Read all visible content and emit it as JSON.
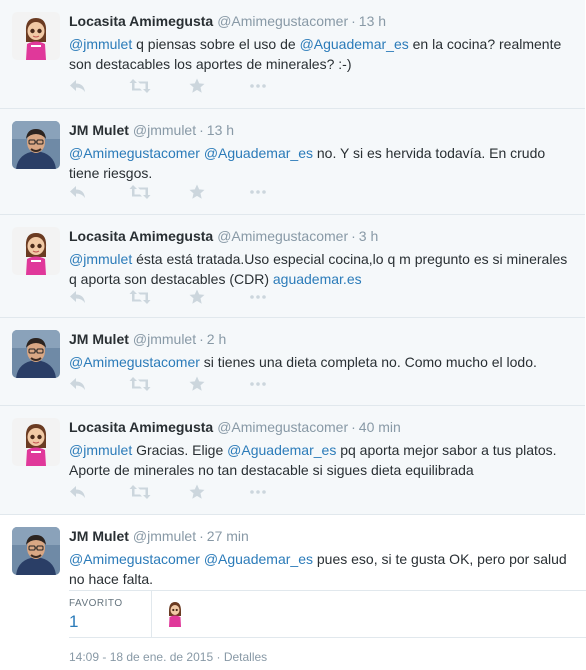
{
  "tweets": [
    {
      "fullname": "Locasita Amimegusta",
      "username": "@Amimegustacomer",
      "time": "13 h",
      "avatar": "locasita-avatar",
      "parts": [
        {
          "t": "@jmmulet",
          "link": true
        },
        {
          "t": " q piensas sobre el uso de ",
          "link": false
        },
        {
          "t": "@Aguademar_es",
          "link": true
        },
        {
          "t": " en la cocina? realmente son destacables los aportes de minerales? :-)",
          "link": false
        }
      ]
    },
    {
      "fullname": "JM Mulet",
      "username": "@jmmulet",
      "time": "13 h",
      "avatar": "jmmulet-avatar",
      "parts": [
        {
          "t": "@Amimegustacomer",
          "link": true
        },
        {
          "t": " ",
          "link": false
        },
        {
          "t": "@Aguademar_es",
          "link": true
        },
        {
          "t": " no. Y si es hervida todavía. En crudo tiene riesgos.",
          "link": false
        }
      ]
    },
    {
      "fullname": "Locasita Amimegusta",
      "username": "@Amimegustacomer",
      "time": "3 h",
      "avatar": "locasita-avatar",
      "parts": [
        {
          "t": "@jmmulet",
          "link": true
        },
        {
          "t": " ésta está tratada.Uso especial cocina,lo q m pregunto es si minerales q aporta son destacables (CDR) ",
          "link": false
        },
        {
          "t": "aguademar.es",
          "link": true
        }
      ]
    },
    {
      "fullname": "JM Mulet",
      "username": "@jmmulet",
      "time": "2 h",
      "avatar": "jmmulet-avatar",
      "parts": [
        {
          "t": "@Amimegustacomer",
          "link": true
        },
        {
          "t": " si tienes una dieta completa no. Como mucho el lodo.",
          "link": false
        }
      ]
    },
    {
      "fullname": "Locasita Amimegusta",
      "username": "@Amimegustacomer",
      "time": "40 min",
      "avatar": "locasita-avatar",
      "parts": [
        {
          "t": "@jmmulet",
          "link": true
        },
        {
          "t": " Gracias. Elige ",
          "link": false
        },
        {
          "t": "@Aguademar_es",
          "link": true
        },
        {
          "t": " pq aporta mejor sabor a tus platos. Aporte de minerales no tan destacable si sigues dieta equilibrada",
          "link": false
        }
      ]
    },
    {
      "fullname": "JM Mulet",
      "username": "@jmmulet",
      "time": "27 min",
      "avatar": "jmmulet-avatar",
      "parts": [
        {
          "t": "@Amimegustacomer",
          "link": true
        },
        {
          "t": " ",
          "link": false
        },
        {
          "t": "@Aguademar_es",
          "link": true
        },
        {
          "t": " pues eso, si te gusta OK, pero por salud no hace falta.",
          "link": false
        }
      ]
    }
  ],
  "stats": {
    "favorites_label": "FAVORITO",
    "favorites_count": "1"
  },
  "meta": {
    "timestamp": "14:09 - 18 de ene. de 2015",
    "separator": "·",
    "details": "Detalles"
  },
  "colors": {
    "link": "#2b7bb9",
    "muted": "#8899a6",
    "icon": "#ccd6dd"
  }
}
